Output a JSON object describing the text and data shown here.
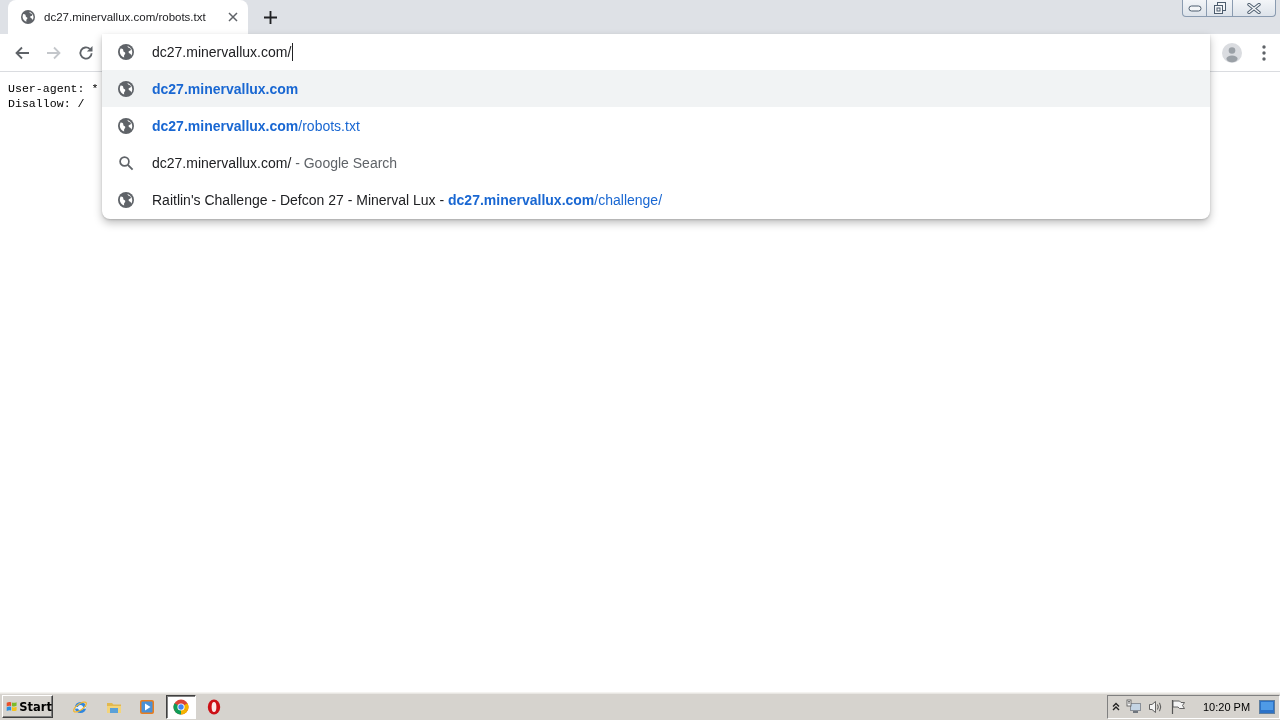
{
  "tabs": [
    {
      "title": "dc27.minervallux.com/robots.txt",
      "selected": true
    }
  ],
  "toolbar": {
    "buttons": [
      {
        "kind": "back",
        "disabled": false
      },
      {
        "kind": "forward",
        "disabled": true
      },
      {
        "kind": "reload",
        "disabled": false
      }
    ]
  },
  "omnibox": {
    "value": "dc27.minervallux.com/",
    "suggestions": [
      {
        "kind": "page",
        "selected": true,
        "segments": [
          {
            "kind": "match",
            "text": "dc27.minervallux.com"
          }
        ]
      },
      {
        "kind": "page",
        "selected": false,
        "segments": [
          {
            "kind": "match",
            "text": "dc27.minervallux.com"
          },
          {
            "kind": "url",
            "text": "/robots.txt"
          }
        ]
      },
      {
        "kind": "search",
        "selected": false,
        "segments": [
          {
            "kind": "text",
            "text": "dc27.minervallux.com/"
          },
          {
            "kind": "hint",
            "text": " - Google Search"
          }
        ]
      },
      {
        "kind": "page",
        "selected": false,
        "segments": [
          {
            "kind": "text",
            "text": "Raitlin's Challenge - Defcon 27 - Minerval Lux - "
          },
          {
            "kind": "match",
            "text": "dc27.minervallux.com"
          },
          {
            "kind": "url",
            "text": "/challenge/"
          }
        ]
      }
    ]
  },
  "page": {
    "lines": [
      "User-agent: *",
      "Disallow: /"
    ]
  },
  "taskbar": {
    "start_label": "Start",
    "apps": [
      {
        "kind": "orbit",
        "selected": false
      },
      {
        "kind": "folder",
        "selected": false
      },
      {
        "kind": "player",
        "selected": false
      },
      {
        "kind": "pinwheel",
        "selected": true
      },
      {
        "kind": "ring",
        "selected": false
      }
    ],
    "clock": "10:20 PM"
  }
}
